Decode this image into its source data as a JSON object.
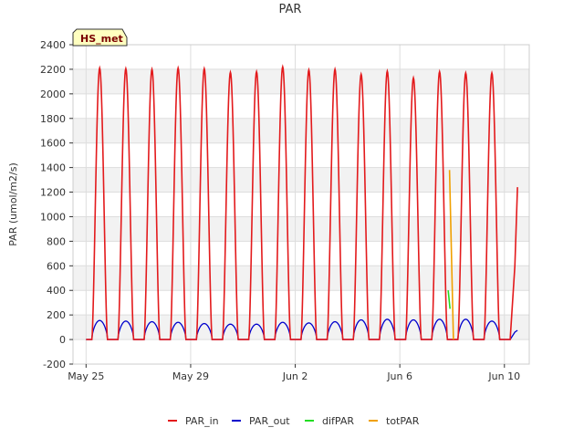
{
  "chart_data": {
    "type": "line",
    "title": "PAR",
    "ylabel": "PAR (umol/m2/s)",
    "xlabel": "",
    "badge": "HS_met",
    "ylim": [
      -200,
      2400
    ],
    "xlim": [
      -0.5,
      16.95
    ],
    "grid": true,
    "yticks": [
      -200,
      0,
      200,
      400,
      600,
      800,
      1000,
      1200,
      1400,
      1600,
      1800,
      2000,
      2200,
      2400
    ],
    "xticks": [
      {
        "day": 0,
        "label": "May 25"
      },
      {
        "day": 4,
        "label": "May 29"
      },
      {
        "day": 8,
        "label": "Jun 2"
      },
      {
        "day": 12,
        "label": "Jun 6"
      },
      {
        "day": 16,
        "label": "Jun 10"
      }
    ],
    "series": [
      {
        "name": "PAR_in",
        "color": "#e31a1c"
      },
      {
        "name": "PAR_out",
        "color": "#0000cc"
      },
      {
        "name": "difPAR",
        "color": "#22dd22"
      },
      {
        "name": "totPAR",
        "color": "#f0a000"
      }
    ],
    "daily": {
      "par_in_peak": [
        2210,
        2205,
        2200,
        2210,
        2205,
        2175,
        2180,
        2220,
        2195,
        2200,
        2160,
        2185,
        2130,
        2180,
        2170,
        2170
      ],
      "par_out_peak": [
        155,
        150,
        145,
        140,
        130,
        125,
        125,
        140,
        135,
        145,
        160,
        165,
        160,
        165,
        165,
        150
      ]
    },
    "partial_day": {
      "day": 16.5,
      "par_in": 1240,
      "par_out": 75
    },
    "difpar_points": [
      {
        "x": 13.85,
        "y": 400
      },
      {
        "x": 13.92,
        "y": 250
      }
    ],
    "totpar_points": [
      {
        "x": 13.9,
        "y": 1380
      },
      {
        "x": 14.05,
        "y": 0
      }
    ]
  },
  "legend": [
    {
      "label": "PAR_in",
      "color": "#e31a1c"
    },
    {
      "label": "PAR_out",
      "color": "#0000cc"
    },
    {
      "label": "difPAR",
      "color": "#22dd22"
    },
    {
      "label": "totPAR",
      "color": "#f0a000"
    }
  ]
}
